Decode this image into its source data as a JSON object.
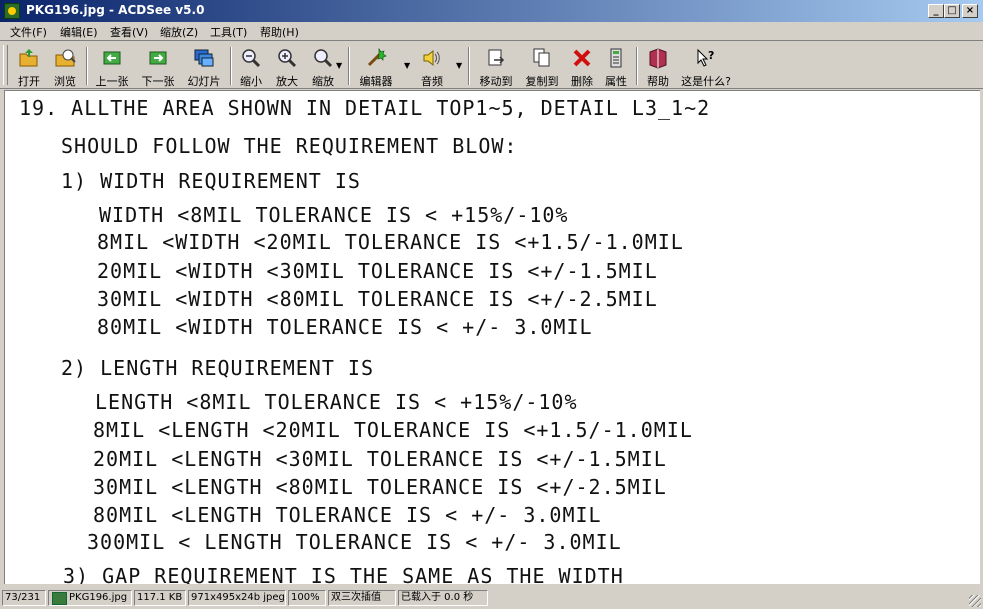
{
  "window": {
    "title": "PKG196.jpg - ACDSee v5.0",
    "controls": [
      "_",
      "□",
      "×"
    ]
  },
  "menu": [
    {
      "label": "文件(F)"
    },
    {
      "label": "编辑(E)"
    },
    {
      "label": "查看(V)"
    },
    {
      "label": "缩放(Z)"
    },
    {
      "label": "工具(T)"
    },
    {
      "label": "帮助(H)"
    }
  ],
  "toolbar": {
    "open": "打开",
    "browse": "浏览",
    "prev": "上一张",
    "next": "下一张",
    "slideshow": "幻灯片",
    "zoom_out": "缩小",
    "zoom_in": "放大",
    "zoom": "缩放",
    "editor": "编辑器",
    "audio": "音频",
    "move_to": "移动到",
    "copy_to": "复制到",
    "delete": "删除",
    "properties": "属性",
    "help": "帮助",
    "whats_this": "这是什么?"
  },
  "document": {
    "lines": [
      "19. ALLTHE AREA SHOWN IN DETAIL TOP1~5, DETAIL L3_1~2",
      "SHOULD FOLLOW THE REQUIREMENT BLOW:",
      "1) WIDTH REQUIREMENT IS",
      "WIDTH <8MIL TOLERANCE IS < +15%/-10%",
      "8MIL   <WIDTH <20MIL TOLERANCE IS <+1.5/-1.0MIL",
      "20MIL <WIDTH <30MIL TOLERANCE IS <+/-1.5MIL",
      "30MIL <WIDTH <80MIL TOLERANCE IS <+/-2.5MIL",
      "80MIL <WIDTH TOLERANCE IS < +/- 3.0MIL",
      "2) LENGTH REQUIREMENT IS",
      "LENGTH <8MIL TOLERANCE IS < +15%/-10%",
      "8MIL   <LENGTH <20MIL TOLERANCE IS <+1.5/-1.0MIL",
      "20MIL <LENGTH <30MIL TOLERANCE IS <+/-1.5MIL",
      "30MIL <LENGTH <80MIL TOLERANCE IS <+/-2.5MIL",
      "80MIL <LENGTH TOLERANCE IS < +/- 3.0MIL",
      "300MIL < LENGTH TOLERANCE IS < +/- 3.0MIL",
      "3) GAP REQUIREMENT IS THE SAME AS THE WIDTH"
    ]
  },
  "status": {
    "index": "73/231",
    "filename": "PKG196.jpg",
    "filesize": "117.1 KB",
    "dimensions": "971x495x24b jpeg",
    "zoom": "100%",
    "resample": "双三次插值",
    "loaded": "已载入于 0.0 秒"
  }
}
